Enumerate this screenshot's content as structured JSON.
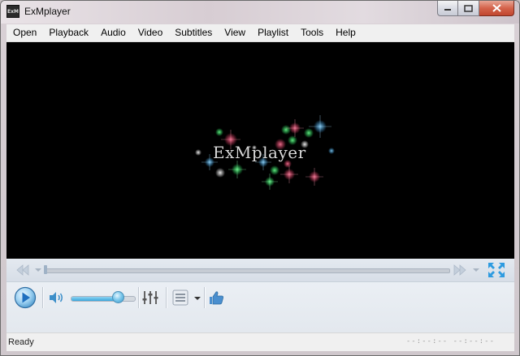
{
  "window": {
    "title": "ExMplayer",
    "icon_label": "ExM"
  },
  "menu": {
    "items": [
      "Open",
      "Playback",
      "Audio",
      "Video",
      "Subtitles",
      "View",
      "Playlist",
      "Tools",
      "Help"
    ]
  },
  "video": {
    "splash_text": "ExMplayer"
  },
  "controls": {
    "seek_progress": 0.0,
    "volume_level": 0.74,
    "icons": [
      "previous-icon",
      "seek-thumb",
      "next-icon",
      "fullscreen-icon",
      "play-icon",
      "volume-icon",
      "equalizer-icon",
      "playlist-icon",
      "dropdown-icon",
      "like-icon"
    ]
  },
  "status": {
    "text": "Ready",
    "time": "--:--:--  --:--:--"
  },
  "colors": {
    "accent": "#3aa7dc",
    "play_button": "#2f7ec4",
    "close_button": "#c8503a"
  }
}
